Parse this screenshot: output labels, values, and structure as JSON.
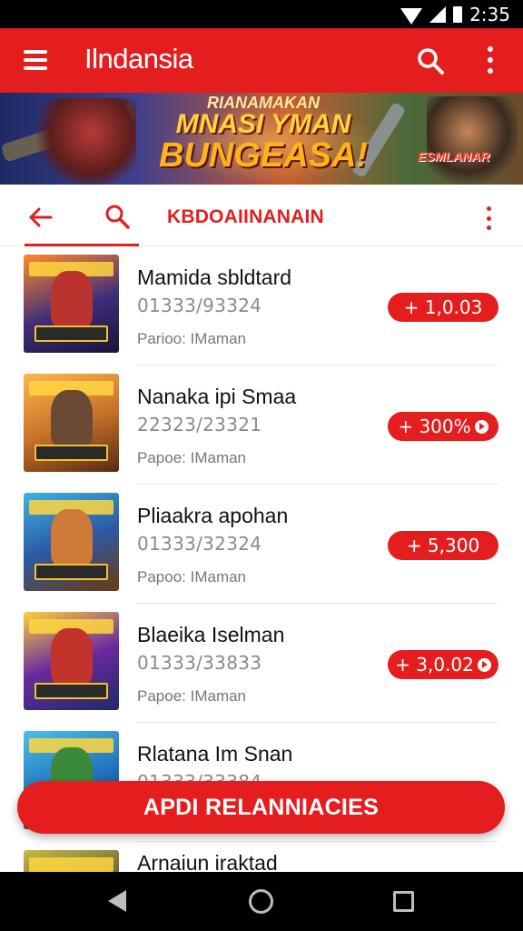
{
  "status_bar": {
    "time": "2:35",
    "icons": [
      "wifi-icon",
      "signal-icon",
      "battery-icon"
    ]
  },
  "app_bar": {
    "title": "Ilndansia",
    "icons": [
      "menu-icon",
      "search-icon",
      "more-vert-icon"
    ]
  },
  "banner": {
    "line1": "RIANAMAKAN",
    "line2": "MNASI YMAN",
    "line3": "BUNGEASA!",
    "tag": "ESMLANAR"
  },
  "sub_toolbar": {
    "title": "KBDOAIINANAIN",
    "icons": [
      "back-arrow-icon",
      "search-icon",
      "more-vert-icon"
    ]
  },
  "items": [
    {
      "title": "Mamida sbldtard",
      "code": "01333/93324",
      "meta": "Parioo: IMaman",
      "badge": "+ 1,0.03",
      "badge_play_icon": false,
      "thumb_color": "#3f2d7a"
    },
    {
      "title": "Nanaka ipi Smaa",
      "code": "22323/23321",
      "meta": "Papoe: IMaman",
      "badge": "+ 300%",
      "badge_play_icon": true,
      "thumb_color": "#c9742b"
    },
    {
      "title": "Pliaakra apohan",
      "code": "01333/32324",
      "meta": "Papoo: IMaman",
      "badge": "+ 5,300",
      "badge_play_icon": false,
      "thumb_color": "#2b5aa5"
    },
    {
      "title": "Blaeika Iselman",
      "code": "01333/33833",
      "meta": "Papoe: IMaman",
      "badge": "+ 3,0.02",
      "badge_play_icon": true,
      "thumb_color": "#6a2aa0"
    },
    {
      "title": "Rlatana Im Snan",
      "code": "01333/33384",
      "meta": "",
      "badge": "",
      "badge_play_icon": false,
      "thumb_color": "#1f6fb8"
    },
    {
      "title": "Arnaiun iraktad",
      "code": "",
      "meta": "",
      "badge": "",
      "badge_play_icon": false,
      "thumb_color": "#4a4a2a"
    }
  ],
  "cta": {
    "label": "APDI RELANNIACIES"
  },
  "nav_bar": {
    "icons": [
      "back-icon",
      "home-icon",
      "recents-icon"
    ]
  },
  "colors": {
    "brand_red": "#e41e1e",
    "status_black": "#000000"
  }
}
